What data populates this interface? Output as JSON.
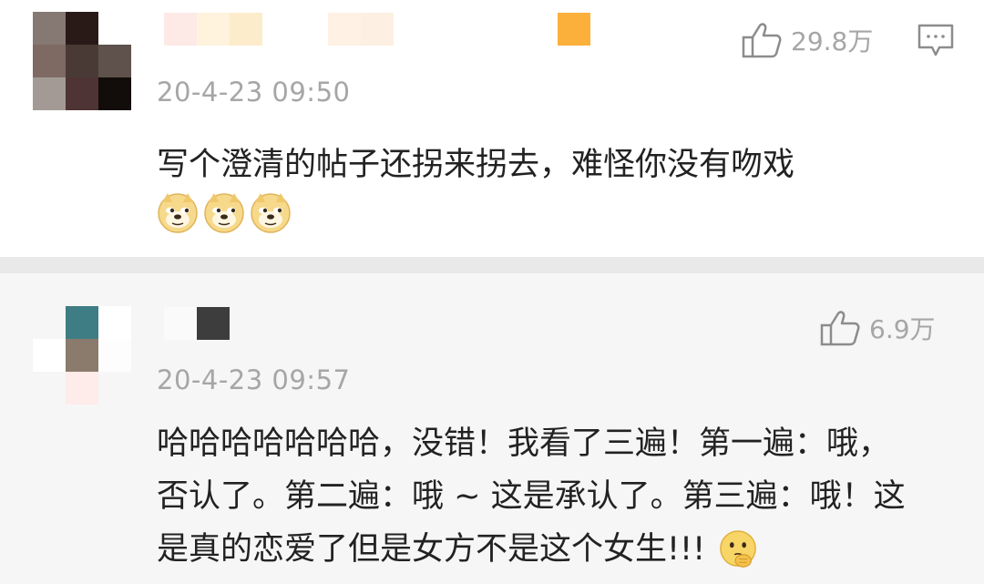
{
  "comments": [
    {
      "time": "20-4-23 09:50",
      "likes": "29.8万",
      "text": "写个澄清的帖子还拐来拐去，难怪你没有吻戏",
      "emojis": [
        "doge-emoji",
        "doge-emoji",
        "doge-emoji"
      ],
      "avatar_colors": [
        "#867872",
        "#2a1a17",
        "#ffffff",
        "#7e6a63",
        "#4a3a36",
        "#5f524c",
        "#a39a95",
        "#4e3434",
        "#120c0a"
      ],
      "username_colors": [
        "#fde9e6",
        "#fff3dd",
        "#fdeccb",
        "#ffffff",
        "#fff2e4",
        "#fdf0e2",
        "#fbb03b"
      ]
    },
    {
      "time": "20-4-23 09:57",
      "likes": "6.9万",
      "text_lines": [
        "哈哈哈哈哈哈哈，没错！我看了三遍！第一遍：哦，",
        "否认了。第二遍：哦 ~ 这是承认了。第三遍：哦！这",
        "是真的恋爱了但是女方不是这个女生!!!"
      ],
      "emojis": [
        "thinking-emoji"
      ],
      "avatar_colors": [
        "#f6f6f6",
        "#3f7d84",
        "#ffffff",
        "#ffffff",
        "#8b7b6c",
        "#fdfdfd",
        "#f6f6f6",
        "#fdecea",
        "#f6f6f6"
      ],
      "username_colors": [
        "#fafafa",
        "#3d3d3d"
      ]
    }
  ]
}
